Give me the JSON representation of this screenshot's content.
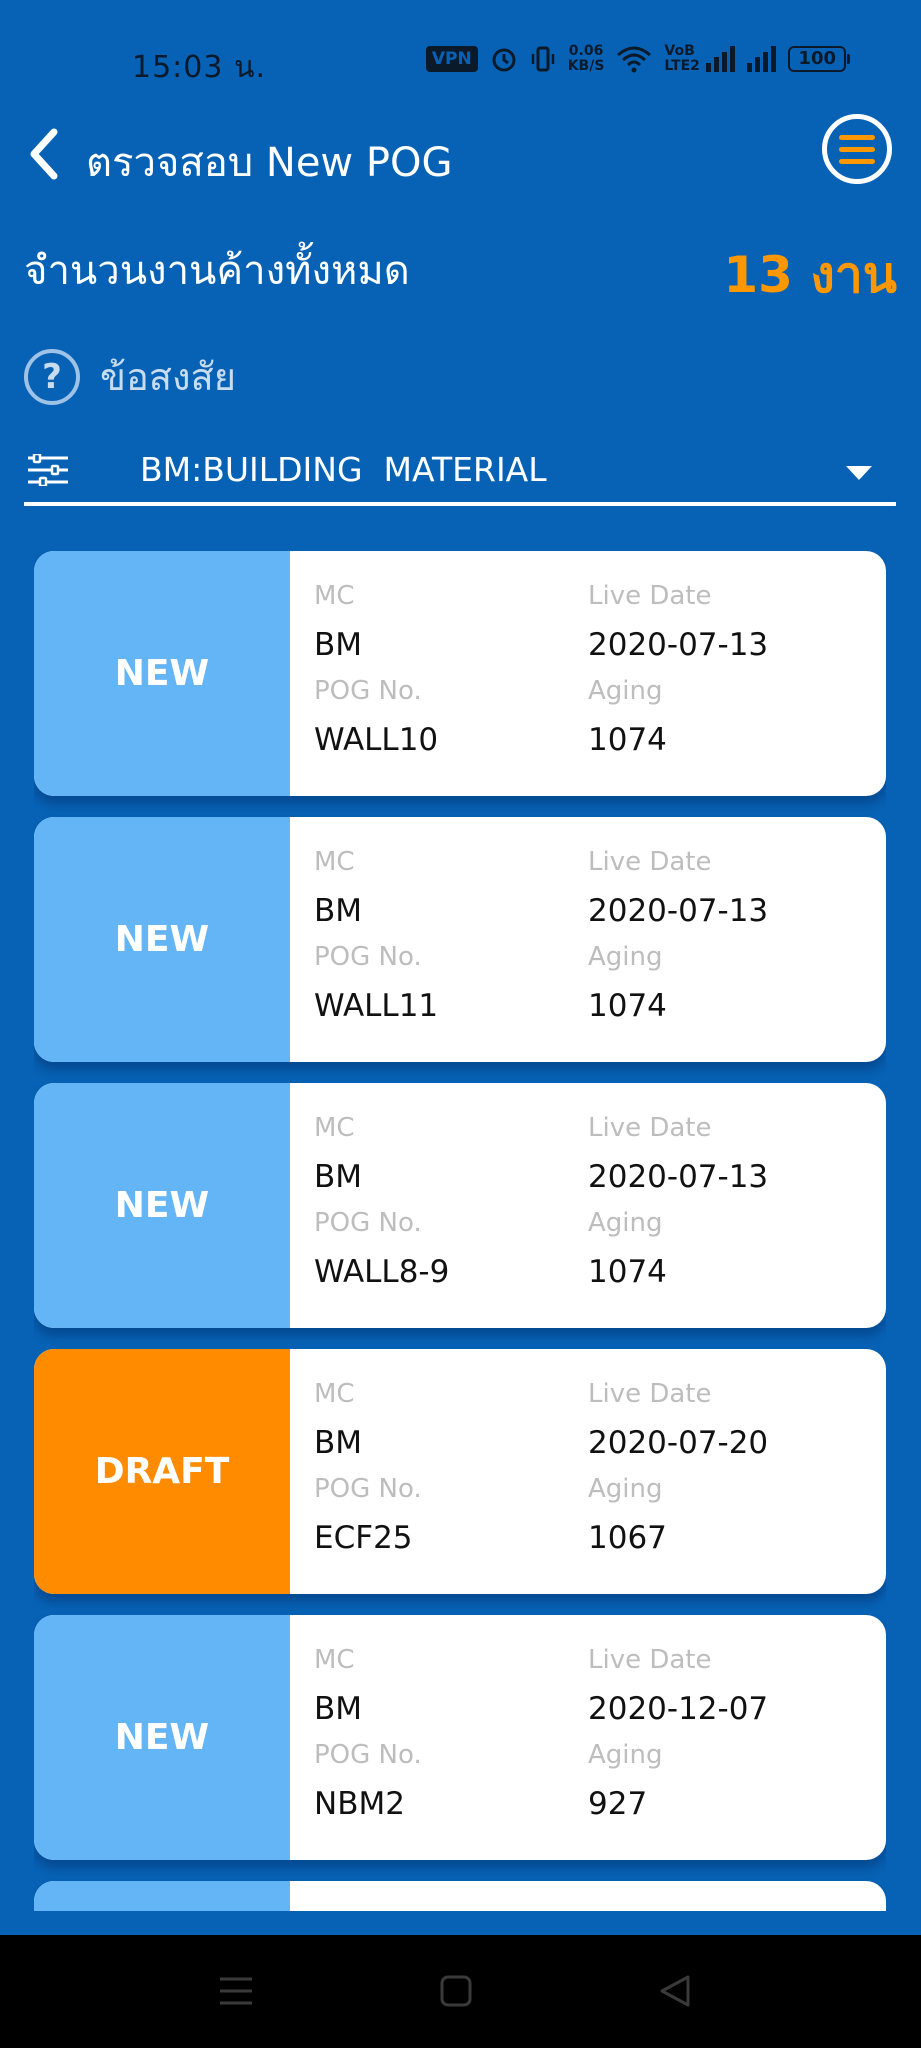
{
  "status_bar": {
    "time": "15:03 น.",
    "vpn": "VPN",
    "speed_value": "0.06",
    "speed_unit": "KB/S",
    "network_label": "VoB LTE2",
    "battery": "100"
  },
  "header": {
    "title": "ตรวจสอบ New POG"
  },
  "summary": {
    "label": "จำนวนงานค้างทั้งหมด",
    "count": "13 งาน"
  },
  "help": {
    "label": "ข้อสงสัย"
  },
  "filter": {
    "value": "BM:BUILDING  MATERIAL"
  },
  "field_labels": {
    "mc": "MC",
    "live_date": "Live Date",
    "pog_no": "POG No.",
    "aging": "Aging"
  },
  "cards": [
    {
      "status": "NEW",
      "mc": "BM",
      "live_date": "2020-07-13",
      "pog_no": "WALL10",
      "aging": "1074"
    },
    {
      "status": "NEW",
      "mc": "BM",
      "live_date": "2020-07-13",
      "pog_no": "WALL11",
      "aging": "1074"
    },
    {
      "status": "NEW",
      "mc": "BM",
      "live_date": "2020-07-13",
      "pog_no": "WALL8-9",
      "aging": "1074"
    },
    {
      "status": "DRAFT",
      "mc": "BM",
      "live_date": "2020-07-20",
      "pog_no": "ECF25",
      "aging": "1067"
    },
    {
      "status": "NEW",
      "mc": "BM",
      "live_date": "2020-12-07",
      "pog_no": "NBM2",
      "aging": "927"
    }
  ],
  "colors": {
    "background": "#0762b5",
    "new_status": "#64b5f6",
    "draft_status": "#ff8c00",
    "accent": "#ff9800"
  },
  "icons": [
    "back-arrow-icon",
    "hamburger-menu-icon",
    "question-icon",
    "filter-sliders-icon",
    "dropdown-arrow-icon",
    "nav-menu-icon",
    "nav-home-icon",
    "nav-back-icon"
  ]
}
